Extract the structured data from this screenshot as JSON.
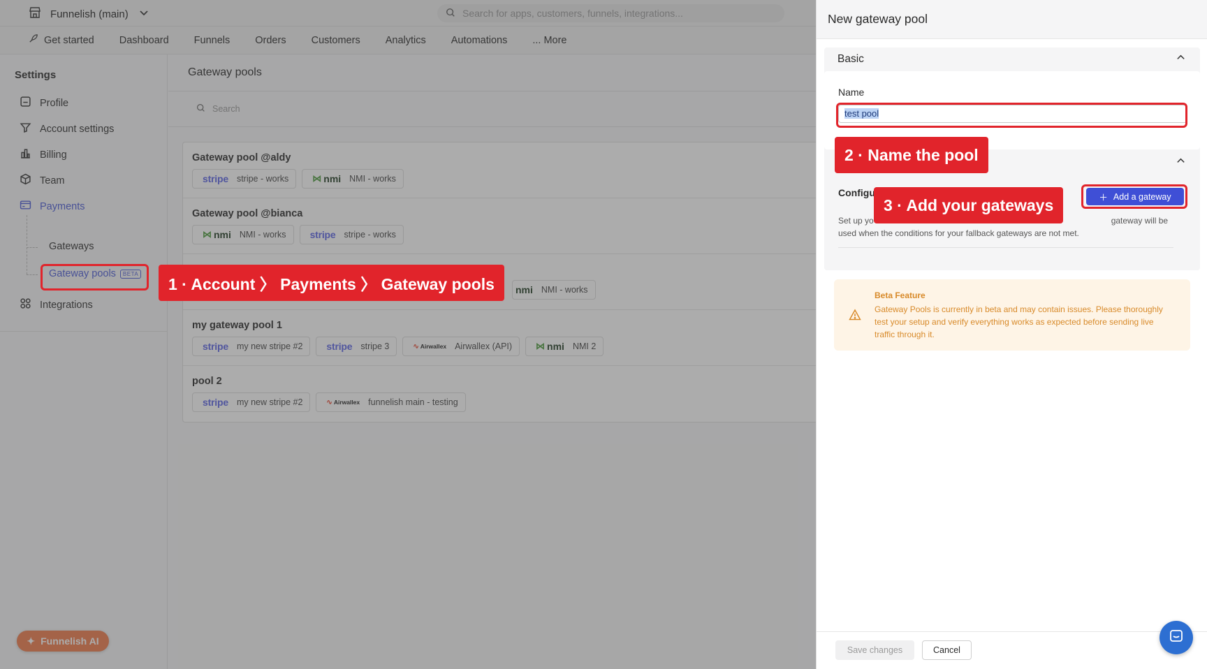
{
  "topbar": {
    "store_name": "Funnelish (main)",
    "search_placeholder": "Search for apps, customers, funnels, integrations..."
  },
  "nav": {
    "items": [
      "Get started",
      "Dashboard",
      "Funnels",
      "Orders",
      "Customers",
      "Analytics",
      "Automations",
      "... More"
    ]
  },
  "sidebar": {
    "title": "Settings",
    "items": [
      {
        "label": "Profile",
        "icon": "profile-icon"
      },
      {
        "label": "Account settings",
        "icon": "filter-icon"
      },
      {
        "label": "Billing",
        "icon": "billing-icon"
      },
      {
        "label": "Team",
        "icon": "cube-icon"
      },
      {
        "label": "Payments",
        "icon": "payments-icon",
        "active": true
      },
      {
        "label": "Integrations",
        "icon": "grid-icon"
      }
    ],
    "sub_items": [
      "Gateways",
      "Gateway pools"
    ],
    "beta_badge": "BETA"
  },
  "main": {
    "title": "Gateway pools",
    "search_placeholder": "Search",
    "pools": [
      {
        "name": "Gateway pool @aldy",
        "gateways": [
          {
            "logo": "stripe",
            "label": "stripe - works"
          },
          {
            "logo": "nmi",
            "label": "NMI - works"
          }
        ]
      },
      {
        "name": "Gateway pool @bianca",
        "gateways": [
          {
            "logo": "nmi",
            "label": "NMI - works"
          },
          {
            "logo": "stripe",
            "label": "stripe - works"
          }
        ]
      },
      {
        "name": "",
        "gateways": [
          {
            "logo": "nmi",
            "label": "NMI - works"
          }
        ]
      },
      {
        "name": "my gateway pool 1",
        "gateways": [
          {
            "logo": "stripe",
            "label": "my new stripe #2"
          },
          {
            "logo": "stripe",
            "label": "stripe 3"
          },
          {
            "logo": "airwallex",
            "label": "Airwallex (API)"
          },
          {
            "logo": "nmi",
            "label": "NMI 2"
          }
        ]
      },
      {
        "name": "pool 2",
        "gateways": [
          {
            "logo": "stripe",
            "label": "my new stripe #2"
          },
          {
            "logo": "airwallex",
            "label": "funnelish main - testing"
          }
        ]
      }
    ]
  },
  "logos": {
    "stripe": "stripe",
    "nmi": "nmi",
    "airwallex": "Airwallex"
  },
  "callouts": {
    "step1": "1 · Account 〉 Payments 〉 Gateway pools",
    "step2": "2 · Name the pool",
    "step3": "3 · Add your gateways"
  },
  "panel": {
    "title": "New gateway pool",
    "basic_section": "Basic",
    "name_label": "Name",
    "name_value": "test pool",
    "config_label": "Configu",
    "config_desc_start": "Set up yo",
    "config_desc_end": "gateway will be used when the conditions for your fallback gateways are not met.",
    "add_gateway": "Add a gateway",
    "beta_title": "Beta Feature",
    "beta_text": "Gateway Pools is currently in beta and may contain issues. Please thoroughly test your setup and verify everything works as expected before sending live traffic through it.",
    "save_label": "Save changes",
    "cancel_label": "Cancel"
  },
  "ai_button": "Funnelish AI",
  "colors": {
    "accent": "#3f4fd6",
    "callout": "#e1242b",
    "warning": "#d88a2a",
    "ai": "#f07a4a"
  }
}
